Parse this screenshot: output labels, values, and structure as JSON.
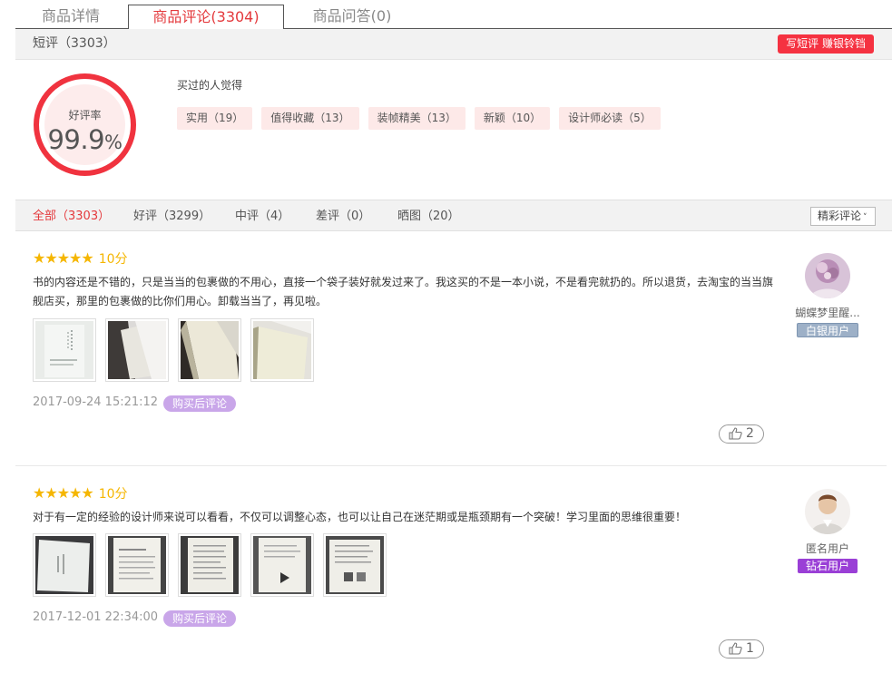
{
  "tabs": [
    {
      "label": "商品详情"
    },
    {
      "label": "商品评论(3304)"
    },
    {
      "label": "商品问答(0)"
    }
  ],
  "short_review": {
    "title": "短评（3303）",
    "write_button": "写短评 赚银铃铛"
  },
  "rating": {
    "label": "好评率",
    "value": "99.9",
    "unit": "%"
  },
  "buyers_think": "买过的人觉得",
  "tags": [
    {
      "label": "实用（19）"
    },
    {
      "label": "值得收藏（13）"
    },
    {
      "label": "装帧精美（13）"
    },
    {
      "label": "新颖（10）"
    },
    {
      "label": "设计师必读（5）"
    }
  ],
  "filters": [
    {
      "label": "全部（3303）"
    },
    {
      "label": "好评（3299）"
    },
    {
      "label": "中评（4）"
    },
    {
      "label": "差评（0）"
    },
    {
      "label": "晒图（20）"
    }
  ],
  "sort": {
    "selected": "精彩评论"
  },
  "reviews": [
    {
      "stars": 5,
      "score": "10分",
      "content": "书的内容还是不错的，只是当当的包裹做的不用心，直接一个袋子装好就发过来了。我这买的不是一本小说，不是看完就扔的。所以退货，去淘宝的当当旗舰店买，那里的包裹做的比你们用心。卸载当当了，再见啦。",
      "image_count": 4,
      "date": "2017-09-24 15:21:12",
      "badge": "购买后评论",
      "likes": "2",
      "user": {
        "name": "蝴蝶梦里醒...",
        "level": "白银用户"
      }
    },
    {
      "stars": 5,
      "score": "10分",
      "content": "对于有一定的经验的设计师来说可以看看，不仅可以调整心态，也可以让自己在迷茫期或是瓶颈期有一个突破！学习里面的思维很重要！",
      "image_count": 5,
      "date": "2017-12-01 22:34:00",
      "badge": "购买后评论",
      "likes": "1",
      "user": {
        "name": "匿名用户",
        "level": "钻石用户"
      }
    }
  ],
  "colors": {
    "accent": "#e4393c",
    "star": "#f5b601",
    "badge": "#c9a6e9",
    "silver_level": "#9db0c7",
    "diamond_level": "#9a3fd6"
  }
}
